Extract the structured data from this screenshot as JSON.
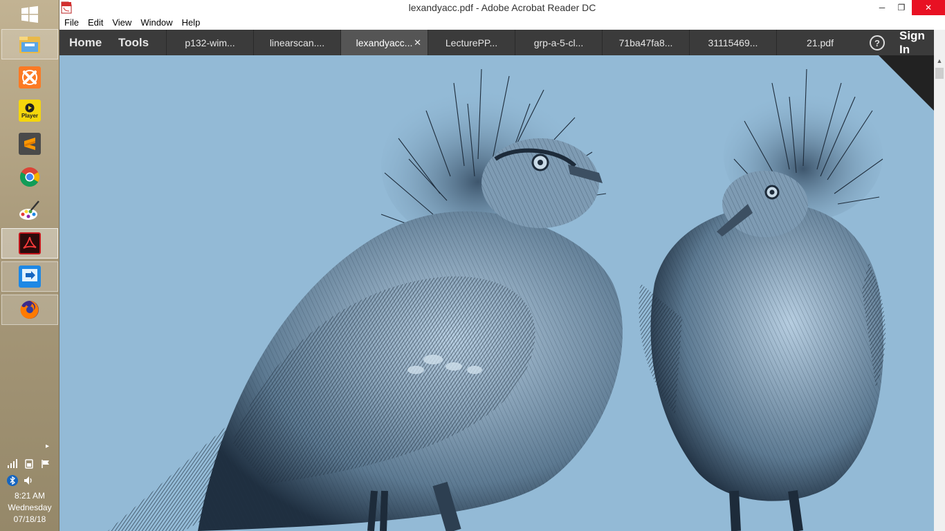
{
  "taskbar": {
    "apps": [
      {
        "name": "file-explorer-icon"
      },
      {
        "name": "xampp-icon"
      },
      {
        "name": "player-icon",
        "label": "Player"
      },
      {
        "name": "sublime-text-icon"
      },
      {
        "name": "chrome-icon"
      },
      {
        "name": "paint-icon"
      },
      {
        "name": "acrobat-icon"
      },
      {
        "name": "remote-desktop-icon"
      },
      {
        "name": "firefox-icon"
      }
    ],
    "clock": {
      "time": "8:21 AM",
      "day": "Wednesday",
      "date": "07/18/18"
    }
  },
  "window": {
    "title": "lexandyacc.pdf - Adobe Acrobat Reader DC",
    "controls": {
      "minimize": "─",
      "restore": "❐",
      "close": "✕"
    },
    "menu": [
      "File",
      "Edit",
      "View",
      "Window",
      "Help"
    ],
    "nav_tabs": {
      "home": "Home",
      "tools": "Tools"
    },
    "doc_tabs": [
      {
        "label": "p132-wim..."
      },
      {
        "label": "linearscan...."
      },
      {
        "label": "lexandyacc...",
        "active": true
      },
      {
        "label": "LecturePP..."
      },
      {
        "label": "grp-a-5-cl..."
      },
      {
        "label": "71ba47fa8..."
      },
      {
        "label": "31115469..."
      },
      {
        "label": "21.pdf"
      }
    ],
    "tab_close": "✕",
    "help": "?",
    "sign_in": "Sign In"
  },
  "colors": {
    "tab_bar": "#3b3b3b",
    "page_background": "#93bad6",
    "close_button": "#e81123"
  }
}
